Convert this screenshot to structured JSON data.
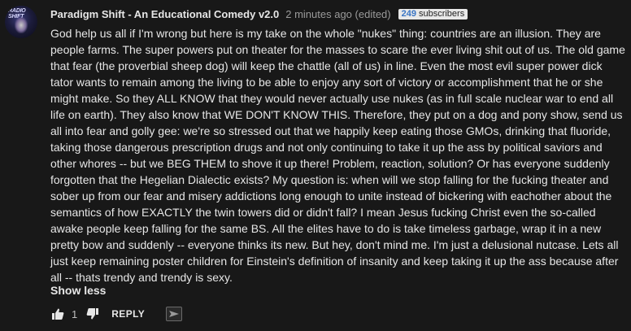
{
  "comment": {
    "author": "Paradigm Shift - An Educational Comedy v2.0",
    "timestamp": "2 minutes ago (edited)",
    "subscriber_count": "249",
    "subscriber_label": "subscribers",
    "avatar_text": "RADIO SHIFT",
    "text": "God help us all if I'm wrong but here is my take on the whole \"nukes\" thing: countries are an illusion. They are people farms. The super powers put on theater for the masses to scare the ever living shit out of us. The old game that fear (the proverbial sheep dog) will keep the chattle (all of us) in line. Even the most evil super power dick tator wants to remain among the living to be able to enjoy any sort of victory or accomplishment that he or she might make. So they ALL KNOW that they would never actually use nukes (as in full scale nuclear war to end all life on earth). They also know that WE DON'T KNOW THIS. Therefore, they put on a  dog and pony show, send us all into fear and golly gee: we're so stressed out that we happily keep eating those GMOs, drinking that fluoride, taking those dangerous prescription drugs and not only continuing to take it up the ass by political saviors and other whores -- but we BEG THEM to shove it up there! Problem, reaction, solution? Or has everyone suddenly forgotten that the Hegelian Dialectic exists? My question is: when will we stop falling for the fucking theater and sober up from our fear and misery addictions long enough to unite instead of bickering with eachother about the semantics of how EXACTLY the twin towers did or didn't fall? I mean Jesus fucking Christ even the so-called awake people keep falling for the same BS. All the elites have to do is take timeless garbage, wrap it in a new pretty bow and suddenly -- everyone thinks its new. But hey, don't mind me. I'm just a delusional nutcase. Lets all just keep remaining poster children for Einstein's definition of insanity and keep taking it up the ass because after all -- thats trendy and trendy is sexy.",
    "show_less_label": "Show less",
    "like_count": "1",
    "reply_label": "REPLY"
  },
  "icons": {
    "like": "thumbs-up-icon",
    "dislike": "thumbs-down-icon",
    "share": "share-icon"
  },
  "colors": {
    "background": "#181818",
    "text": "#e6e6e6",
    "muted": "#9a9a9a",
    "subscriber_count": "#3a75c4"
  }
}
